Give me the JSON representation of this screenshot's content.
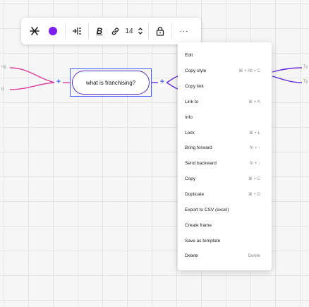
{
  "toolbar": {
    "buttons": [
      {
        "name": "mindmap-shape-icon"
      },
      {
        "name": "color-fill-icon",
        "color": "#7a1ff0"
      },
      {
        "name": "text-align-icon"
      },
      {
        "name": "bold-icon"
      },
      {
        "name": "link-icon"
      },
      {
        "name": "font-size-value",
        "value": "14"
      },
      {
        "name": "font-size-stepper-icon"
      },
      {
        "name": "lock-icon"
      },
      {
        "name": "more-options-icon"
      }
    ],
    "font_size": "14"
  },
  "node": {
    "text": "what is franchising?",
    "border_color": "#5b2ec9",
    "selection_color": "#4262ff"
  },
  "edges": {
    "left_color": "#e0409e",
    "right_color": "#6a2ee0",
    "left_labels": [
      "ng",
      "g"
    ],
    "right_labels": [
      "Ty",
      "Ty"
    ]
  },
  "menu": {
    "items": [
      {
        "label": "Edit",
        "shortcut": ""
      },
      {
        "label": "Copy style",
        "shortcut": "⌘ + Alt + C"
      },
      {
        "label": "Copy link",
        "shortcut": ""
      },
      {
        "label": "Link to",
        "shortcut": "⌘ + K"
      },
      {
        "label": "Info",
        "shortcut": ""
      },
      {
        "label": "Lock",
        "shortcut": "⌘ + L"
      },
      {
        "label": "Bring forward",
        "shortcut": "fn + ↑"
      },
      {
        "label": "Send backward",
        "shortcut": "fn + ↓"
      },
      {
        "label": "Copy",
        "shortcut": "⌘ + C"
      },
      {
        "label": "Duplicate",
        "shortcut": "⌘ + D"
      },
      {
        "label": "Export to CSV (excel)",
        "shortcut": ""
      },
      {
        "label": "Create frame",
        "shortcut": ""
      },
      {
        "label": "Save as template",
        "shortcut": ""
      },
      {
        "label": "Delete",
        "shortcut": "Delete"
      }
    ]
  }
}
